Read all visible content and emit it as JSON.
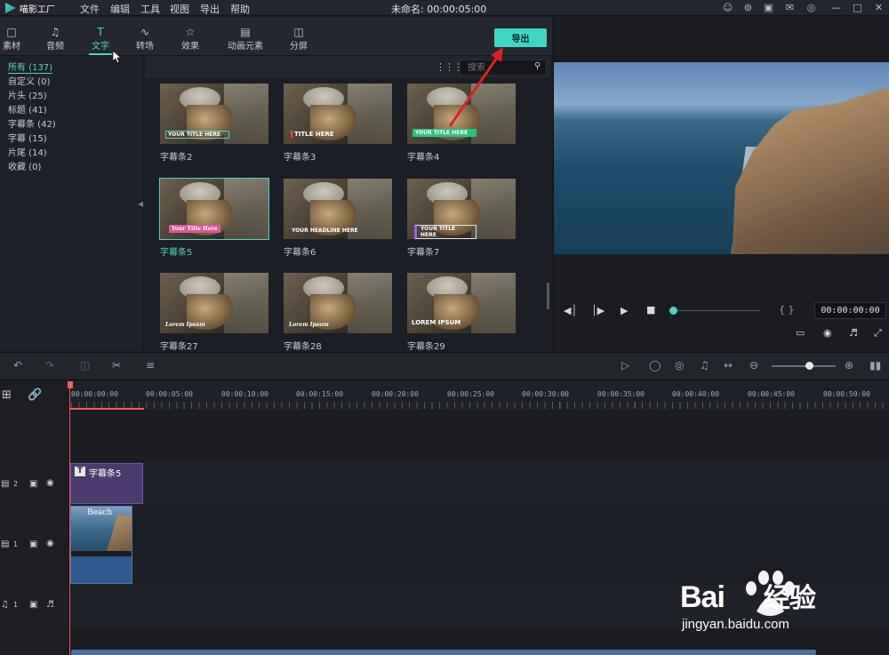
{
  "app": {
    "logo_text": "喵影工厂",
    "title": "未命名: 00:00:05:00"
  },
  "menu": [
    "文件",
    "编辑",
    "工具",
    "视图",
    "导出",
    "帮助"
  ],
  "tabs": [
    {
      "label": "素材",
      "icon": "folder-icon"
    },
    {
      "label": "音频",
      "icon": "music-icon"
    },
    {
      "label": "文字",
      "icon": "text-icon",
      "active": true
    },
    {
      "label": "转场",
      "icon": "transition-icon"
    },
    {
      "label": "效果",
      "icon": "effects-icon"
    },
    {
      "label": "动画元素",
      "icon": "image-icon"
    },
    {
      "label": "分屏",
      "icon": "split-screen-icon"
    }
  ],
  "export_label": "导出",
  "categories": [
    "所有 (137)",
    "自定义 (0)",
    "片头 (25)",
    "标题 (41)",
    "字幕条 (42)",
    "字幕 (15)",
    "片尾 (14)",
    "收藏 (0)"
  ],
  "search": {
    "placeholder": "搜索"
  },
  "thumbnails": [
    {
      "name": "字幕条2",
      "overlay": "YOUR TITLE HERE"
    },
    {
      "name": "字幕条3",
      "overlay": "TITLE HERE"
    },
    {
      "name": "字幕条4",
      "overlay": "YOUR TITLE HERE"
    },
    {
      "name": "字幕条5",
      "overlay": "Your Title Here",
      "selected": true
    },
    {
      "name": "字幕条6",
      "overlay": "YOUR HEADLINE HERE"
    },
    {
      "name": "字幕条7",
      "overlay": "YOUR TITLE HERE"
    },
    {
      "name": "字幕条27",
      "overlay": "Lorem Ipsum"
    },
    {
      "name": "字幕条28",
      "overlay": "Lorem Ipsum"
    },
    {
      "name": "字幕条29",
      "overlay": "LOREM IPSUM"
    }
  ],
  "preview": {
    "timecode": "00:00:00:00",
    "progress": 0
  },
  "ruler": [
    "00:00:00:00",
    "00:00:05:00",
    "00:00:10:00",
    "00:00:15:00",
    "00:00:20:00",
    "00:00:25:00",
    "00:00:30:00",
    "00:00:35:00",
    "00:00:40:00",
    "00:00:45:00",
    "00:00:50:00"
  ],
  "tracks": [
    {
      "label": "2",
      "type": "video"
    },
    {
      "label": "1",
      "type": "video"
    },
    {
      "label": "1",
      "type": "audio"
    }
  ],
  "clips": {
    "text_clip": "字幕条5",
    "video_clip": "Beach"
  },
  "zoom_level": 0.55,
  "watermark": {
    "brand": "Bai",
    "brand2": "经验",
    "url": "jingyan.baidu.com"
  },
  "colors": {
    "accent": "#4fd3c6",
    "playhead": "#ff5a5a",
    "text_clip": "#4b3a6e",
    "video_clip": "#2e5a8f",
    "arrow": "#e02020"
  }
}
